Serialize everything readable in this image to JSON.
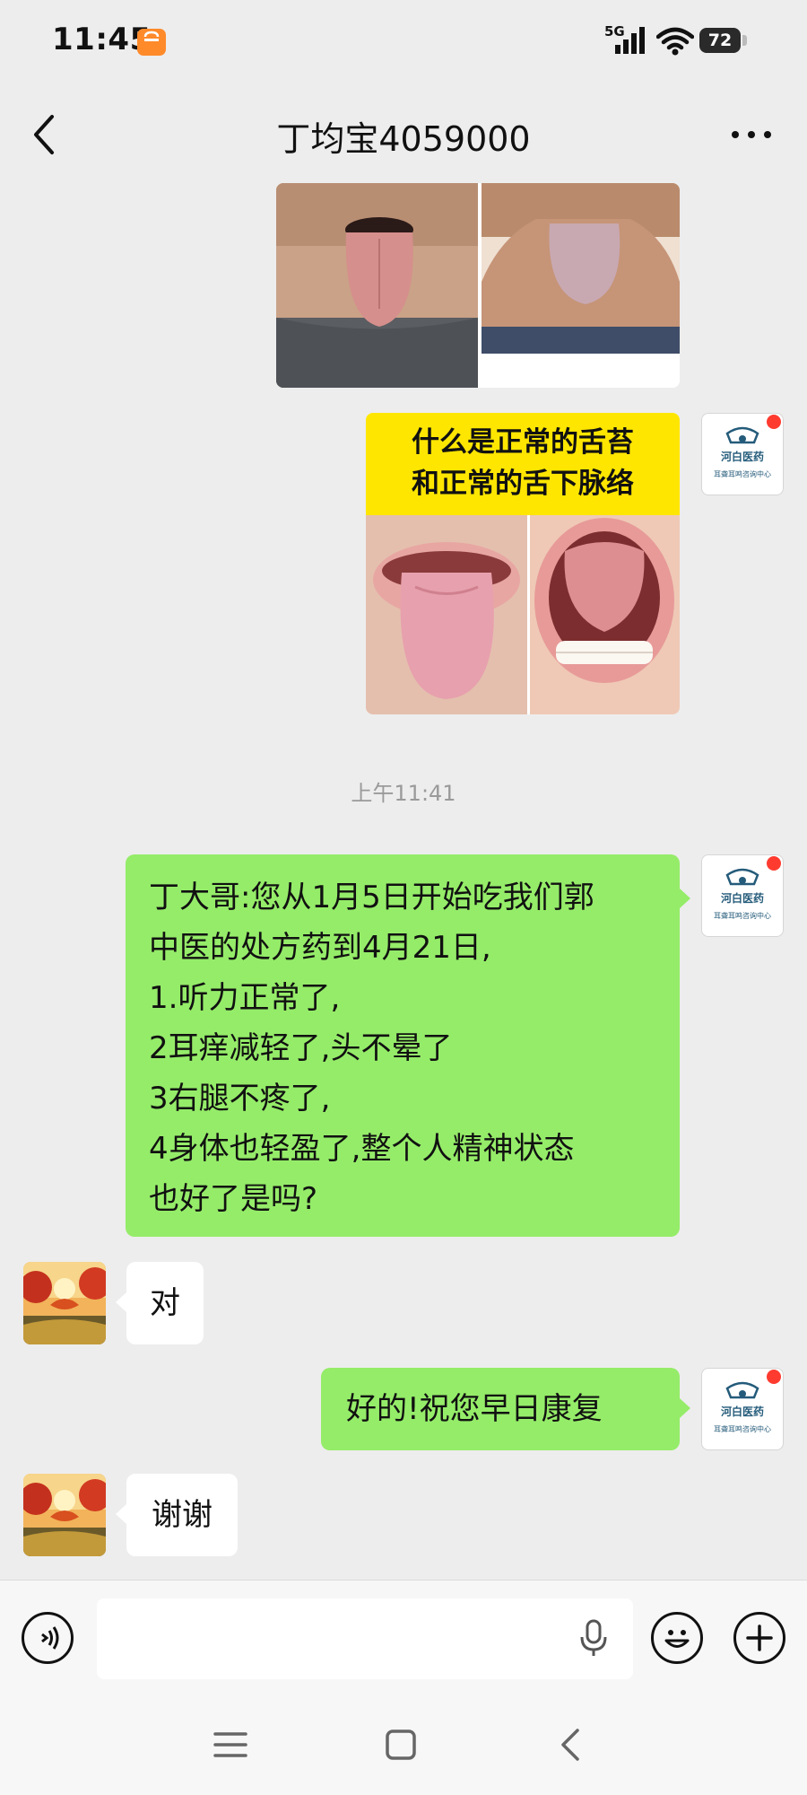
{
  "status_bar": {
    "time": "11:45",
    "network": "5G",
    "battery": "72",
    "icons": [
      "app-notification-icon",
      "signal-icon",
      "wifi-icon",
      "battery-icon"
    ]
  },
  "header": {
    "title": "丁均宝4059000",
    "back_icon": "chevron-left-icon",
    "more_icon": "more-dots-icon"
  },
  "images": {
    "tongue_card_2": {
      "heading_line1": "什么是正常的舌苔",
      "heading_line2": "和正常的舌下脉络"
    }
  },
  "sender_avatar": {
    "logo_text": "河白医药",
    "caption": "耳聋耳鸣咨询中心"
  },
  "timestamp": "上午11:41",
  "messages": [
    {
      "side": "right",
      "lines": [
        "丁大哥:您从1月5日开始吃我们郭",
        "中医的处方药到4月21日,",
        "1.听力正常了,",
        "2耳痒减轻了,头不晕了",
        "3右腿不疼了,",
        "4身体也轻盈了,整个人精神状态",
        "也好了是吗?"
      ]
    },
    {
      "side": "left",
      "text": "对"
    },
    {
      "side": "right",
      "text": "好的!祝您早日康复"
    },
    {
      "side": "left",
      "text": "谢谢"
    }
  ],
  "input_bar": {
    "voice_icon": "voice-mode-icon",
    "mic_icon": "microphone-icon",
    "emoji_icon": "emoji-icon",
    "plus_icon": "plus-icon",
    "value": ""
  },
  "system_nav": [
    "menu-icon",
    "home-square-icon",
    "back-triangle-icon"
  ],
  "colors": {
    "background": "#ededed",
    "bubble_green": "#95ec69",
    "bubble_white": "#ffffff",
    "heading_banner": "#ffe600",
    "status_dot": "#ff3b30"
  }
}
